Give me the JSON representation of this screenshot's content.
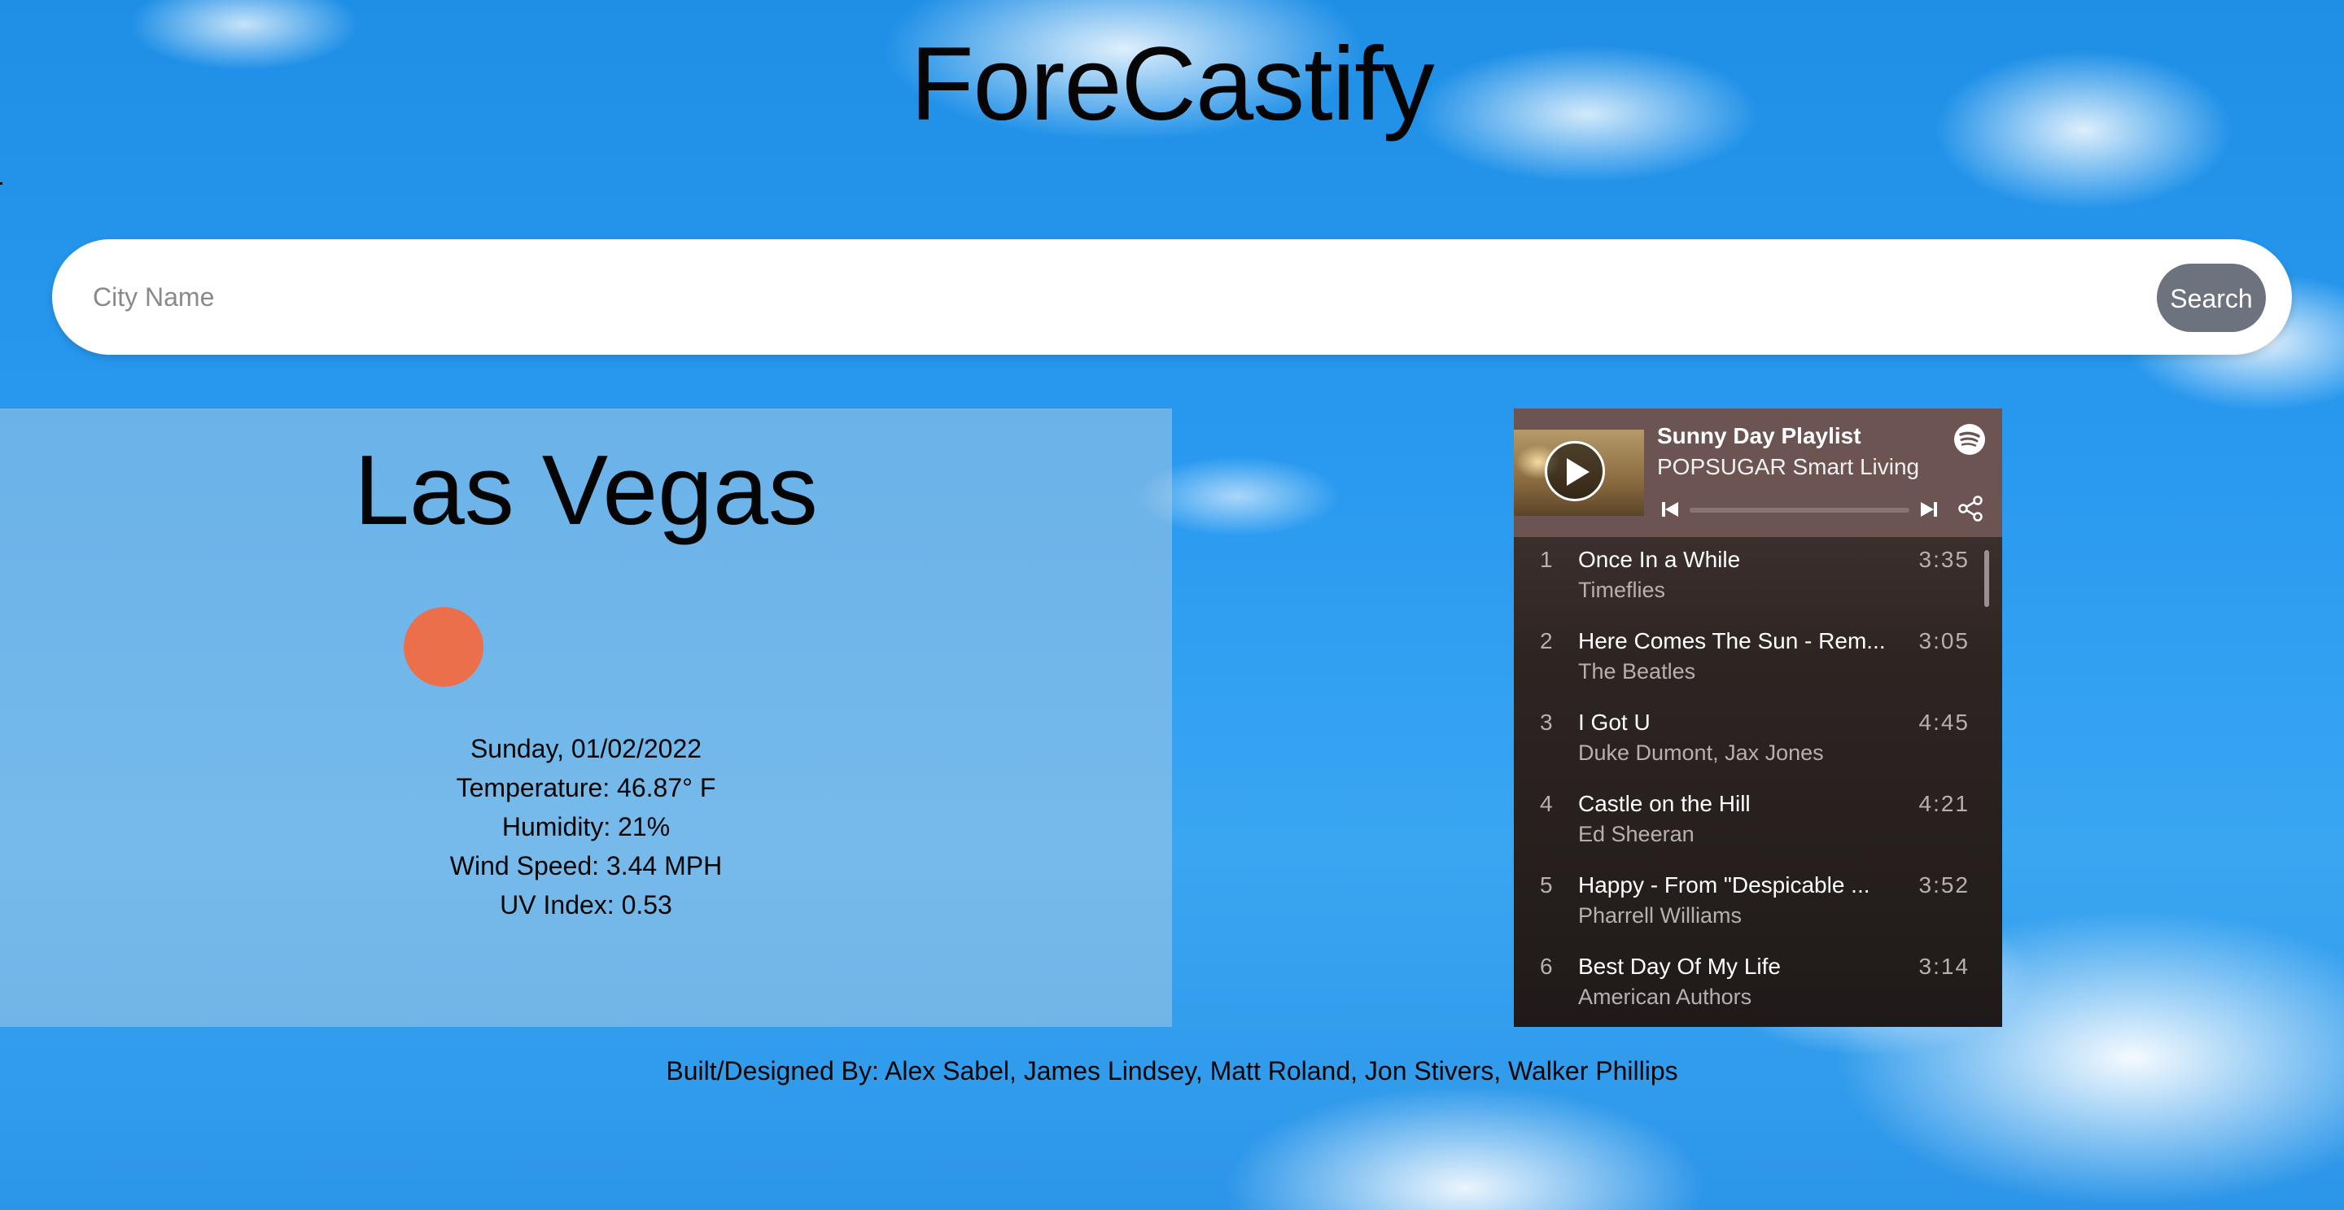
{
  "app": {
    "title": "ForeCastify"
  },
  "search": {
    "placeholder": "City Name",
    "value": "",
    "button_label": "Search"
  },
  "weather": {
    "city": "Las Vegas",
    "icon": "sun-icon",
    "icon_color": "#ec6f4c",
    "date": "Sunday, 01/02/2022",
    "temperature": "Temperature: 46.87° F",
    "humidity": "Humidity: 21%",
    "wind_speed": "Wind Speed: 3.44 MPH",
    "uv_index": "UV Index: 0.53"
  },
  "spotify": {
    "playlist_title": "Sunny Day Playlist",
    "playlist_owner": "POPSUGAR Smart Living",
    "logo": "spotify-logo",
    "tracks": [
      {
        "num": "1",
        "title": "Once In a While",
        "artist": "Timeflies",
        "duration": "3:35"
      },
      {
        "num": "2",
        "title": "Here Comes The Sun - Rem...",
        "artist": "The Beatles",
        "duration": "3:05"
      },
      {
        "num": "3",
        "title": "I Got U",
        "artist": "Duke Dumont, Jax Jones",
        "duration": "4:45"
      },
      {
        "num": "4",
        "title": "Castle on the Hill",
        "artist": "Ed Sheeran",
        "duration": "4:21"
      },
      {
        "num": "5",
        "title": "Happy - From \"Despicable ...",
        "artist": "Pharrell Williams",
        "duration": "3:52"
      },
      {
        "num": "6",
        "title": "Best Day Of My Life",
        "artist": "American Authors",
        "duration": "3:14"
      }
    ]
  },
  "footer": {
    "credits": "Built/Designed By: Alex Sabel, James Lindsey, Matt Roland, Jon Stivers, Walker Phillips"
  }
}
